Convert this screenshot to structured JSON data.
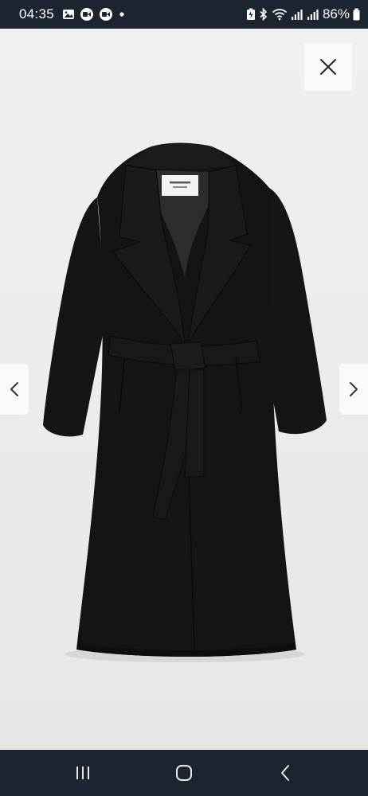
{
  "status_bar": {
    "time": "04:35",
    "battery_percent": "86%",
    "notification_icons": [
      "gallery-icon",
      "video-call-icon",
      "video-call-icon",
      "notification-dot-icon"
    ],
    "system_icons": [
      "battery-saver-icon",
      "bluetooth-icon",
      "wifi-icon",
      "signal-icon",
      "signal-icon",
      "battery-icon"
    ]
  },
  "viewer": {
    "image_subject": "black-wrap-coat",
    "close_icon": "close-icon",
    "prev_icon": "chevron-left-icon",
    "next_icon": "chevron-right-icon"
  },
  "colors": {
    "system_bars": "#1c2430",
    "background": "#ececeb",
    "button_bg": "#fafafa",
    "coat": "#141414"
  },
  "nav_bar": {
    "buttons": [
      "recent-apps-icon",
      "home-icon",
      "back-icon"
    ]
  }
}
